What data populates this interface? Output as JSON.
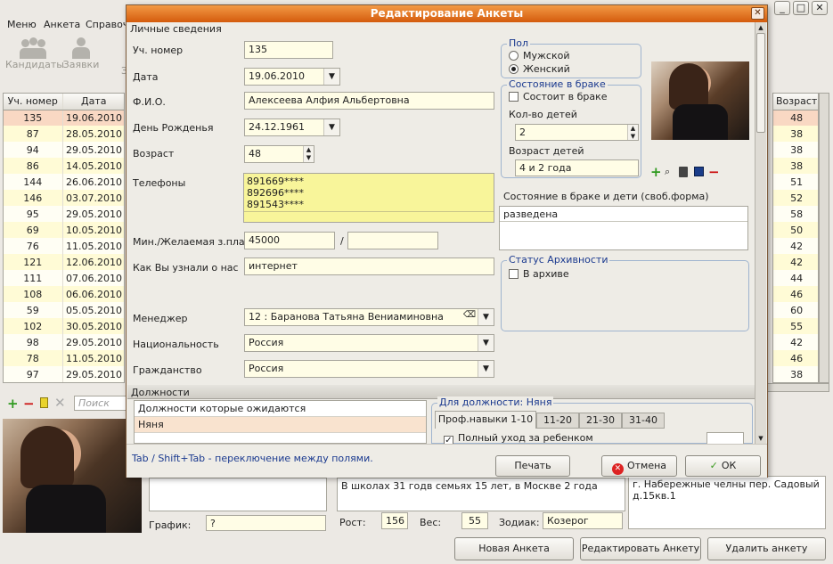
{
  "main": {
    "menu": [
      "Меню",
      "Анкета",
      "Справоч"
    ],
    "toolbar": {
      "candidates": "Кандидаты",
      "requests": "Заявки",
      "third": "З"
    },
    "grid": {
      "headers": [
        "Уч. номер",
        "Дата"
      ],
      "rows": [
        [
          "135",
          "19.06.2010"
        ],
        [
          "87",
          "28.05.2010"
        ],
        [
          "94",
          "29.05.2010"
        ],
        [
          "86",
          "14.05.2010"
        ],
        [
          "144",
          "26.06.2010"
        ],
        [
          "146",
          "03.07.2010"
        ],
        [
          "95",
          "29.05.2010"
        ],
        [
          "69",
          "10.05.2010"
        ],
        [
          "76",
          "11.05.2010"
        ],
        [
          "121",
          "12.06.2010"
        ],
        [
          "111",
          "07.06.2010"
        ],
        [
          "108",
          "06.06.2010"
        ],
        [
          "59",
          "05.05.2010"
        ],
        [
          "102",
          "30.05.2010"
        ],
        [
          "98",
          "29.05.2010"
        ],
        [
          "78",
          "11.05.2010"
        ],
        [
          "97",
          "29.05.2010"
        ]
      ]
    },
    "right_grid": {
      "header": "Возраст",
      "values": [
        "48",
        "38",
        "38",
        "38",
        "51",
        "52",
        "58",
        "50",
        "42",
        "42",
        "44",
        "46",
        "60",
        "55",
        "42",
        "46",
        "38"
      ]
    },
    "search_placeholder": "Поиск",
    "bottom": {
      "schedule_label": "График:",
      "schedule_value": "?",
      "experience": "В школах 31 годв семьях 15 лет, в Москве 2 года",
      "height_label": "Рост:",
      "height": "156",
      "weight_label": "Вес:",
      "weight": "55",
      "zodiac_label": "Зодиак:",
      "zodiac": "Козерог",
      "address": "г. Набережные челны пер. Садовый д.15кв.1"
    },
    "buttons": {
      "new": "Новая Анкета",
      "edit": "Редактировать Анкету",
      "delete": "Удалить анкету"
    },
    "win_controls": [
      "_",
      "□",
      "✕"
    ]
  },
  "dialog": {
    "title": "Редактирование Анкеты",
    "close": "✕",
    "section_personal": "Личные сведения",
    "fields": {
      "reg_num_label": "Уч. номер",
      "reg_num": "135",
      "date_label": "Дата",
      "date": "19.06.2010",
      "fio_label": "Ф.И.О.",
      "fio": "Алексеева Алфия Альбертовна",
      "birthday_label": "День Рожденья",
      "birthday": "24.12.1961",
      "age_label": "Возраст",
      "age": "48",
      "phones_label": "Телефоны",
      "phones": [
        "891669****",
        "892696****",
        "891543****"
      ],
      "salary_label": "Мин./Желаемая з.плата",
      "salary_min": "45000",
      "salary_sep": "/",
      "salary_max": "",
      "source_label": "Как Вы узнали о нас",
      "source": "интернет",
      "manager_label": "Менеджер",
      "manager": "12 : Баранова Татьяна Вениаминовна",
      "nationality_label": "Национальность",
      "nationality": "Россия",
      "citizenship_label": "Гражданство",
      "citizenship": "Россия"
    },
    "gender": {
      "title": "Пол",
      "male": "Мужской",
      "female": "Женский",
      "selected": "female"
    },
    "marriage": {
      "title": "Состояние в браке",
      "married": "Состоит в браке",
      "children_label": "Кол-во детей",
      "children": "2",
      "children_age_label": "Возраст детей",
      "children_age": "4 и  2 года"
    },
    "marriage_free_label": "Состояние в браке и дети (своб.форма)",
    "marriage_free": "разведена",
    "archive": {
      "title": "Статус Архивности",
      "label": "В архиве"
    },
    "positions": {
      "section": "Должности",
      "list_header": "Должности которые ожидаются",
      "items": [
        "Няня"
      ],
      "for_position": "Для должности: Няня",
      "tabs": [
        "Проф.навыки 1-10",
        "11-20",
        "21-30",
        "31-40"
      ],
      "skill": "Полный уход за ребенком"
    },
    "hint": "Tab / Shift+Tab - переключение между полями.",
    "buttons": {
      "print": "Печать",
      "cancel": "Отмена",
      "ok": "ОК"
    }
  },
  "colors": {
    "title_bar": "#e06a10",
    "field_bg": "#fffde6",
    "phones_bg": "#f8f59a",
    "selected_row": "#f9d8c3",
    "group_title": "#1b3a8f"
  }
}
